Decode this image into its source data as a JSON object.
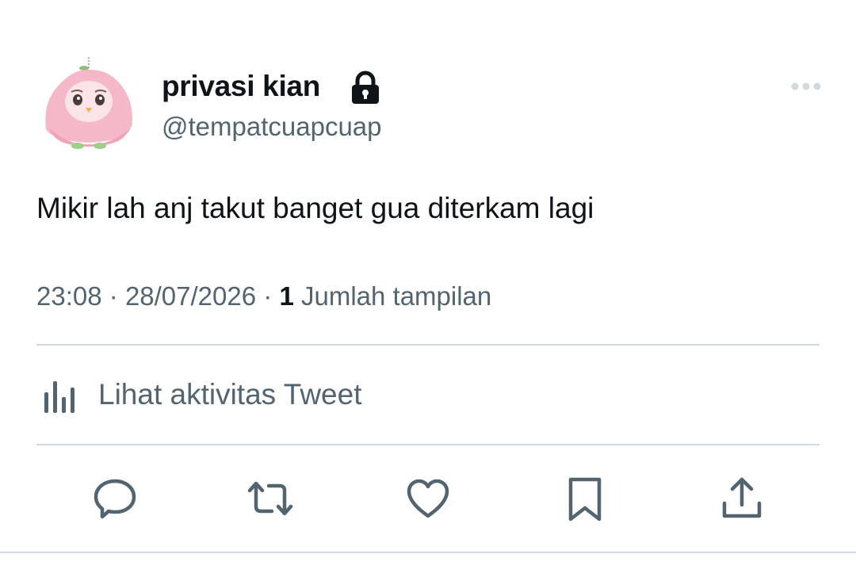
{
  "user": {
    "display_name": "privasi kian",
    "handle": "@tempatcuapcuap",
    "protected": true
  },
  "tweet": {
    "text": "Mikir lah anj takut banget gua diterkam lagi",
    "time": "23:08",
    "separator": "·",
    "date": "28/07/2026",
    "views_count": "1",
    "views_label": "Jumlah tampilan"
  },
  "activity": {
    "label": "Lihat aktivitas Tweet"
  },
  "actions": [
    "reply-icon",
    "retweet-icon",
    "like-icon",
    "bookmark-icon",
    "share-icon"
  ],
  "colors": {
    "text_primary": "#0f1419",
    "text_secondary": "#536471",
    "divider": "#cfd9de",
    "avatar_pink": "#f4b8c8"
  }
}
